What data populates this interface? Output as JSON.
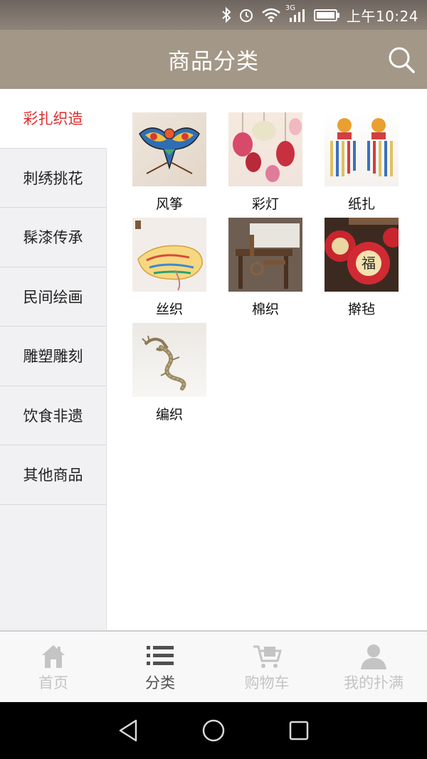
{
  "status_bar": {
    "network": "3G",
    "time": "上午10:24"
  },
  "header": {
    "title": "商品分类",
    "search_icon": "search-icon"
  },
  "sidebar": {
    "items": [
      {
        "label": "彩扎织造",
        "active": true
      },
      {
        "label": "刺绣挑花",
        "active": false
      },
      {
        "label": "髹漆传承",
        "active": false
      },
      {
        "label": "民间绘画",
        "active": false
      },
      {
        "label": "雕塑雕刻",
        "active": false
      },
      {
        "label": "饮食非遗",
        "active": false
      },
      {
        "label": "其他商品",
        "active": false
      }
    ]
  },
  "categories": [
    {
      "label": "风筝",
      "image": "kite"
    },
    {
      "label": "彩灯",
      "image": "lantern"
    },
    {
      "label": "纸扎",
      "image": "paper-craft"
    },
    {
      "label": "丝织",
      "image": "silk"
    },
    {
      "label": "棉织",
      "image": "cotton-loom"
    },
    {
      "label": "擀毡",
      "image": "felt"
    },
    {
      "label": "编织",
      "image": "woven-dragon"
    }
  ],
  "tabbar": {
    "tabs": [
      {
        "label": "首页",
        "icon": "home-icon",
        "active": false
      },
      {
        "label": "分类",
        "icon": "list-icon",
        "active": true
      },
      {
        "label": "购物车",
        "icon": "cart-icon",
        "active": false
      },
      {
        "label": "我的扑满",
        "icon": "user-icon",
        "active": false
      }
    ]
  },
  "colors": {
    "header_bg": "#a39787",
    "active_side": "#e12a2a",
    "tab_inactive": "#c4c4c4",
    "tab_active": "#505050"
  }
}
